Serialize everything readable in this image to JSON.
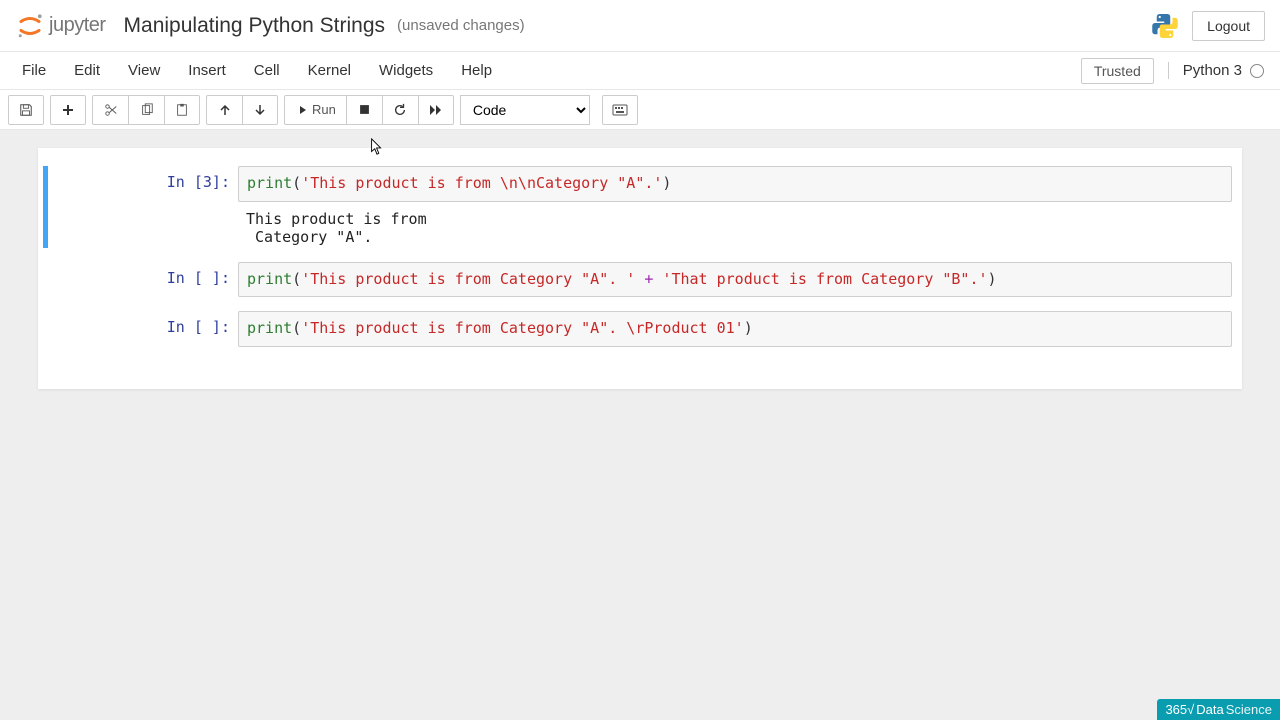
{
  "header": {
    "logo_text": "jupyter",
    "title": "Manipulating Python Strings",
    "save_status": "(unsaved changes)",
    "logout": "Logout"
  },
  "menu": {
    "items": [
      "File",
      "Edit",
      "View",
      "Insert",
      "Cell",
      "Kernel",
      "Widgets",
      "Help"
    ],
    "trusted": "Trusted",
    "kernel": "Python 3"
  },
  "toolbar": {
    "run_label": "Run",
    "cell_type": "Code",
    "icons": {
      "save": "save-icon",
      "add": "plus-icon",
      "cut": "scissors-icon",
      "copy": "copy-icon",
      "paste": "clipboard-icon",
      "up": "arrow-up-icon",
      "down": "arrow-down-icon",
      "run": "play-step-icon",
      "stop": "stop-icon",
      "restart": "refresh-icon",
      "ff": "fast-forward-icon",
      "cmd": "keyboard-icon"
    }
  },
  "cells": [
    {
      "prompt": "In [3]:",
      "code": {
        "fn": "print",
        "open": "(",
        "str": "'This product is from \\n\\nCategory \"A\".'",
        "close": ")"
      },
      "output": "This product is from \n Category \"A\"."
    },
    {
      "prompt": "In [ ]:",
      "code": {
        "fn": "print",
        "open": "(",
        "str1": "'This product is from Category \"A\". '",
        "op": " + ",
        "str2": "'That product is from Category \"B\".'",
        "close": ")"
      }
    },
    {
      "prompt": "In [ ]:",
      "code": {
        "fn": "print",
        "open": "(",
        "str": "'This product is from Category \"A\". \\rProduct 01'",
        "close": ")"
      }
    }
  ],
  "watermark": {
    "prefix": "365√",
    "brand1": "Data",
    "brand2": "Science"
  }
}
